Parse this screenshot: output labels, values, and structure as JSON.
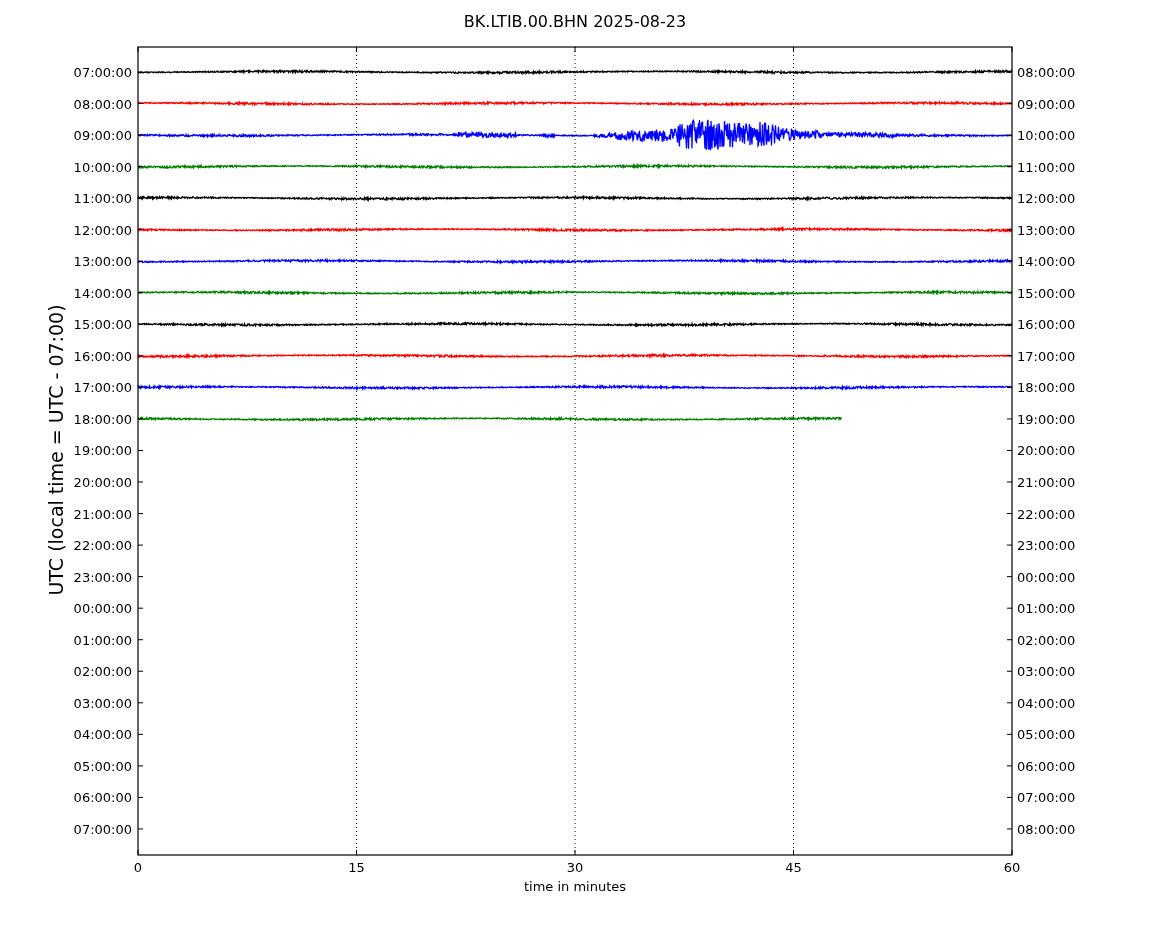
{
  "title": "BK.LTIB.00.BHN 2025-08-23",
  "ylabel": "UTC (local time = UTC - 07:00)",
  "xlabel": "time in minutes",
  "xticks": [
    "0",
    "15",
    "30",
    "45",
    "60"
  ],
  "rows": [
    {
      "left": "07:00:00",
      "right": "08:00:00"
    },
    {
      "left": "08:00:00",
      "right": "09:00:00"
    },
    {
      "left": "09:00:00",
      "right": "10:00:00"
    },
    {
      "left": "10:00:00",
      "right": "11:00:00"
    },
    {
      "left": "11:00:00",
      "right": "12:00:00"
    },
    {
      "left": "12:00:00",
      "right": "13:00:00"
    },
    {
      "left": "13:00:00",
      "right": "14:00:00"
    },
    {
      "left": "14:00:00",
      "right": "15:00:00"
    },
    {
      "left": "15:00:00",
      "right": "16:00:00"
    },
    {
      "left": "16:00:00",
      "right": "17:00:00"
    },
    {
      "left": "17:00:00",
      "right": "18:00:00"
    },
    {
      "left": "18:00:00",
      "right": "19:00:00"
    },
    {
      "left": "19:00:00",
      "right": "20:00:00"
    },
    {
      "left": "20:00:00",
      "right": "21:00:00"
    },
    {
      "left": "21:00:00",
      "right": "22:00:00"
    },
    {
      "left": "22:00:00",
      "right": "23:00:00"
    },
    {
      "left": "23:00:00",
      "right": "00:00:00"
    },
    {
      "left": "00:00:00",
      "right": "01:00:00"
    },
    {
      "left": "01:00:00",
      "right": "02:00:00"
    },
    {
      "left": "02:00:00",
      "right": "03:00:00"
    },
    {
      "left": "03:00:00",
      "right": "04:00:00"
    },
    {
      "left": "04:00:00",
      "right": "05:00:00"
    },
    {
      "left": "05:00:00",
      "right": "06:00:00"
    },
    {
      "left": "06:00:00",
      "right": "07:00:00"
    },
    {
      "left": "07:00:00",
      "right": "08:00:00"
    }
  ],
  "traces": [
    {
      "color": "#000000",
      "kind": "quiet",
      "level": 1
    },
    {
      "color": "#ff0000",
      "kind": "quiet",
      "level": 1
    },
    {
      "color": "#0000ff",
      "kind": "event",
      "level": 1
    },
    {
      "color": "#008000",
      "kind": "quiet",
      "level": 1
    },
    {
      "color": "#000000",
      "kind": "quiet",
      "level": 1
    },
    {
      "color": "#ff0000",
      "kind": "quiet",
      "level": 1
    },
    {
      "color": "#0000ff",
      "kind": "quiet",
      "level": 1
    },
    {
      "color": "#008000",
      "kind": "quiet",
      "level": 1
    },
    {
      "color": "#000000",
      "kind": "quiet",
      "level": 1
    },
    {
      "color": "#ff0000",
      "kind": "quiet",
      "level": 1
    },
    {
      "color": "#0000ff",
      "kind": "quiet",
      "level": 1
    },
    {
      "color": "#008000",
      "kind": "quiet",
      "level": 0.805
    }
  ]
}
